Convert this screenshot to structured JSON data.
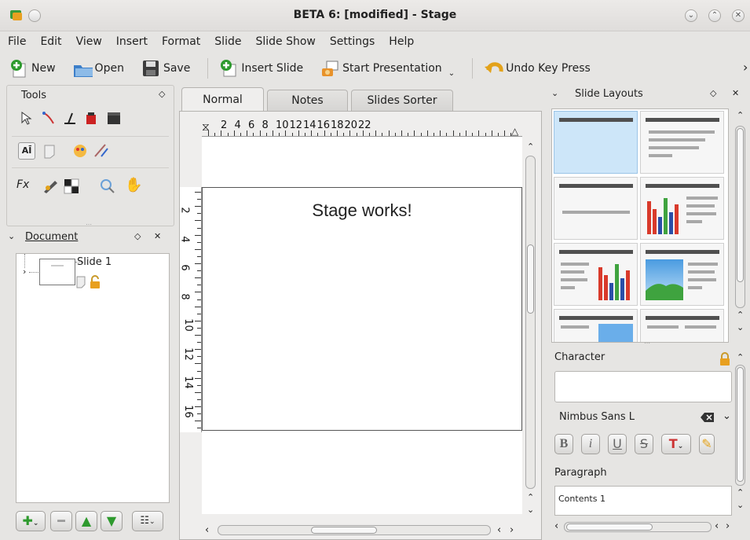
{
  "window": {
    "title": "BETA 6:  [modified] - Stage"
  },
  "menu": [
    "File",
    "Edit",
    "View",
    "Insert",
    "Format",
    "Slide",
    "Slide Show",
    "Settings",
    "Help"
  ],
  "toolbar": {
    "new": "New",
    "open": "Open",
    "save": "Save",
    "insert_slide": "Insert Slide",
    "start_presentation": "Start Presentation",
    "undo": "Undo Key Press",
    "overflow": "›"
  },
  "tools_panel": {
    "title": "Tools"
  },
  "document_panel": {
    "title": "Document",
    "slide_label": "Slide 1"
  },
  "tabs": {
    "normal": "Normal",
    "notes": "Notes",
    "sorter": "Slides Sorter"
  },
  "ruler": {
    "h_numbers": [
      "2",
      "4",
      "6",
      "8",
      "10",
      "12",
      "14",
      "16",
      "18",
      "20",
      "22"
    ],
    "v_numbers": [
      "2",
      "4",
      "6",
      "8",
      "10",
      "12",
      "14",
      "16"
    ]
  },
  "slide": {
    "text": "Stage works!"
  },
  "layouts_panel": {
    "title": "Slide Layouts"
  },
  "character_panel": {
    "title": "Character",
    "font": "Nimbus Sans L"
  },
  "paragraph_panel": {
    "title": "Paragraph",
    "style": "Contents 1"
  },
  "colors": {
    "accent_blue": "#cde6f9",
    "bar_red": "#d93a2b",
    "bar_green": "#3fa33f",
    "bar_blue": "#2a4fa8"
  }
}
